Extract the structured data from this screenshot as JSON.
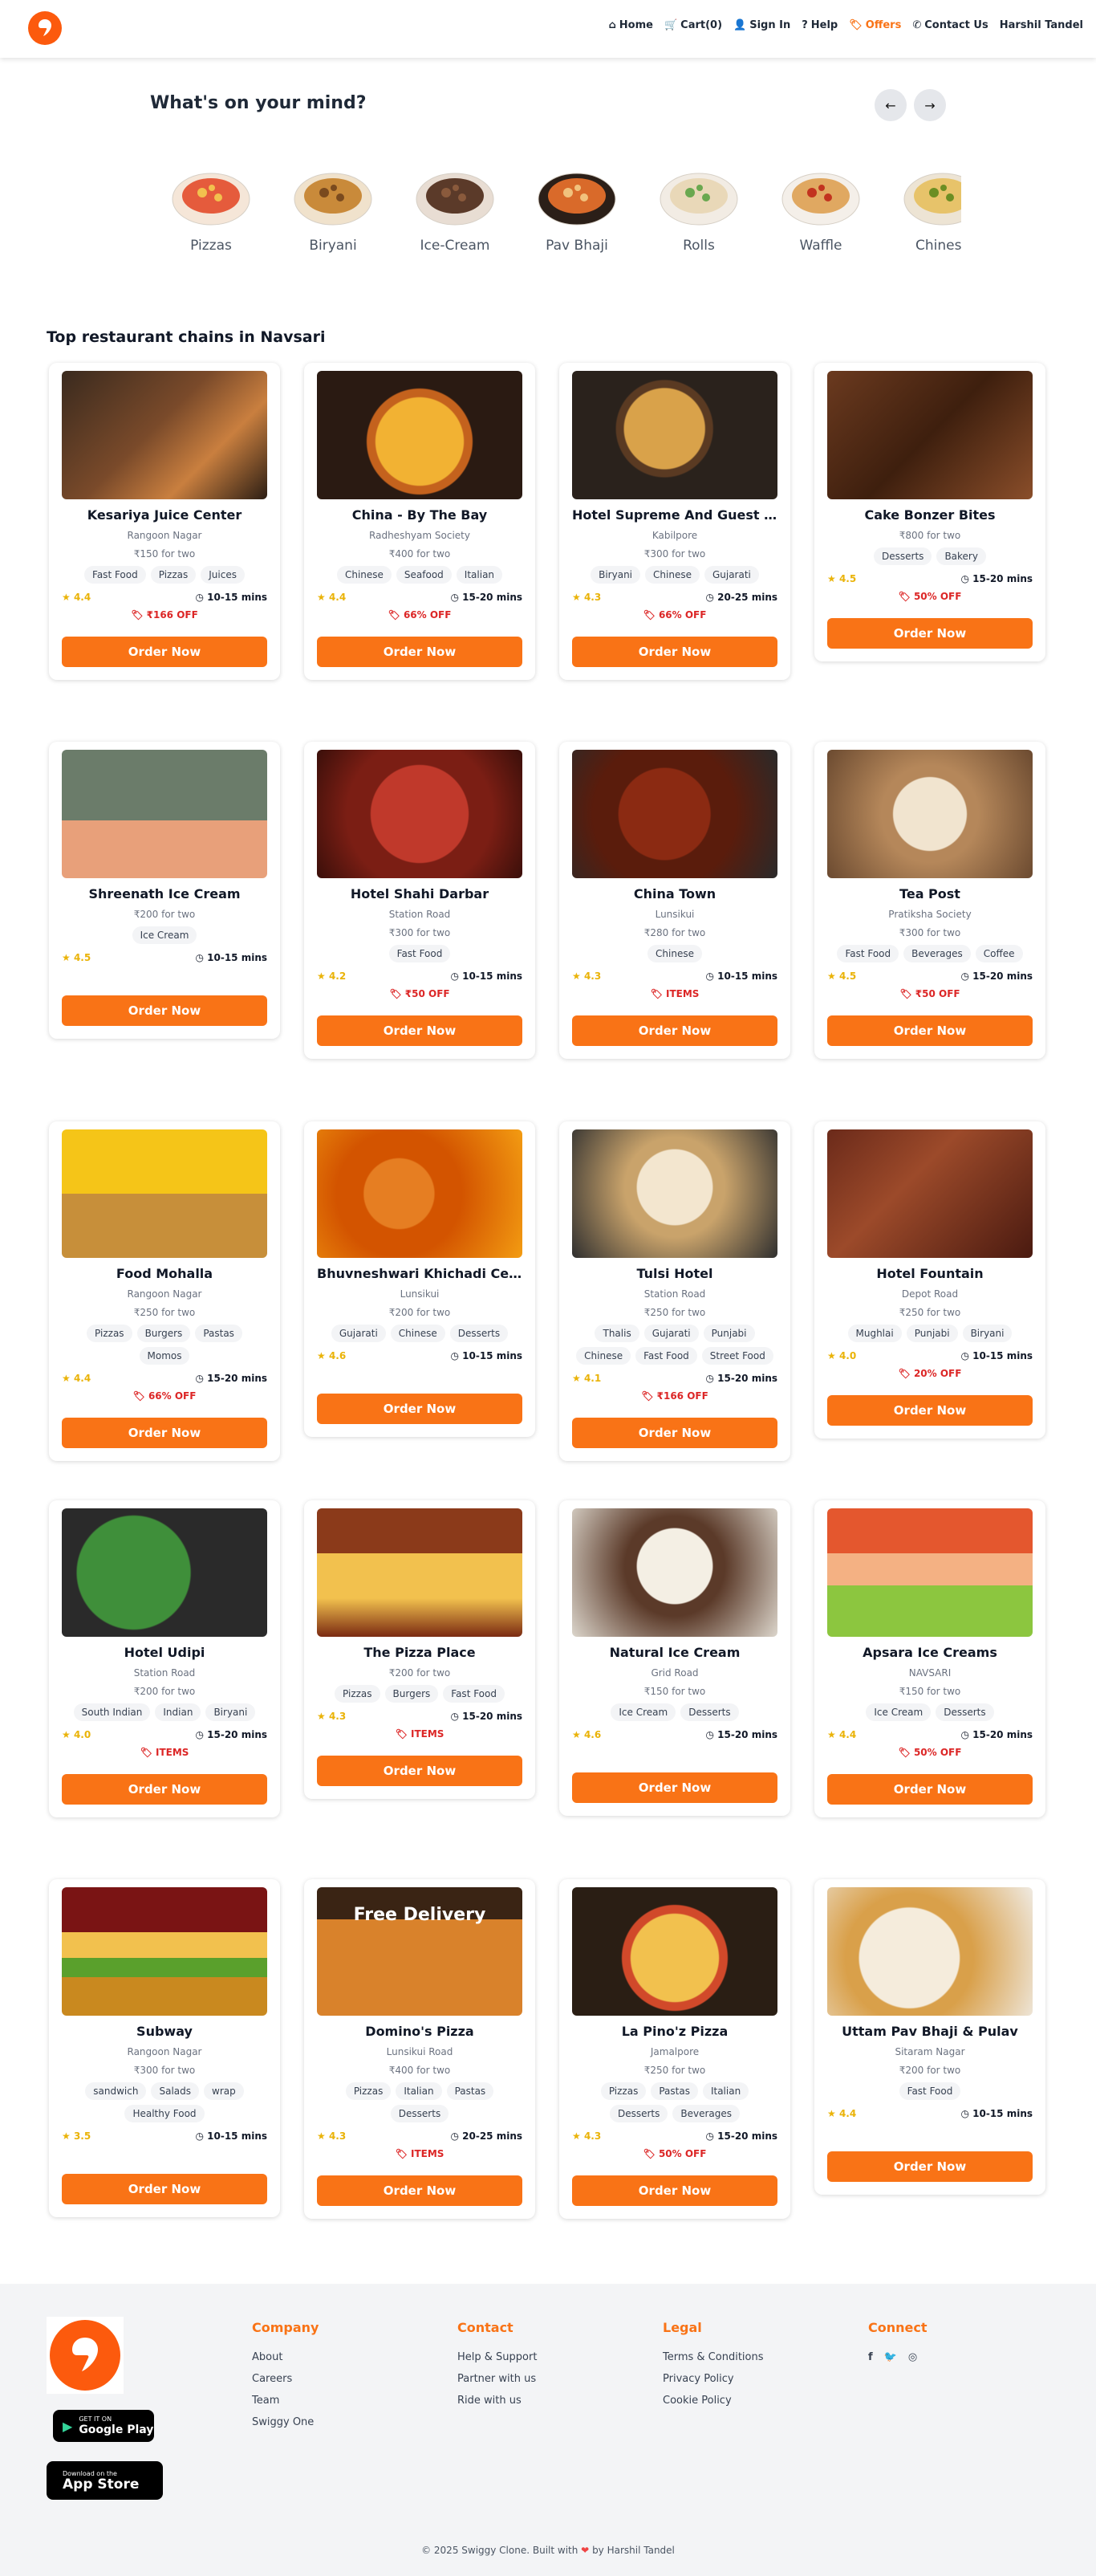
{
  "nav": {
    "links": [
      {
        "label": "Home",
        "icon": "home-icon"
      },
      {
        "label": "Cart(0)",
        "icon": "cart-icon"
      },
      {
        "label": "Sign In",
        "icon": "user-icon"
      },
      {
        "label": "Help",
        "icon": "help-icon"
      },
      {
        "label": "Offers",
        "icon": "tag-icon"
      },
      {
        "label": "Contact Us",
        "icon": "phone-icon"
      },
      {
        "label": "Harshil Tandel",
        "icon": ""
      }
    ]
  },
  "mind": {
    "title": "What's on your mind?",
    "categories": [
      "Pizzas",
      "Biryani",
      "Ice-Cream",
      "Pav Bhaji",
      "Rolls",
      "Waffle",
      "Chinese"
    ]
  },
  "section_title": "Top restaurant chains in Navsari",
  "order_label": "Order Now",
  "restaurants": [
    {
      "name": "Kesariya Juice Center",
      "loc": "Rangoon Nagar",
      "price": "₹150 for two",
      "tags": [
        "Fast Food",
        "Pizzas",
        "Juices"
      ],
      "rating": "4.4",
      "time": "10-15 mins",
      "offer": "₹166 OFF",
      "img": "grill"
    },
    {
      "name": "China - By The Bay",
      "loc": "Radheshyam Society",
      "price": "₹400 for two",
      "tags": [
        "Chinese",
        "Seafood",
        "Italian"
      ],
      "rating": "4.4",
      "time": "15-20 mins",
      "offer": "66% OFF",
      "img": "pizza"
    },
    {
      "name": "Hotel Supreme And Guest House",
      "loc": "Kabilpore",
      "price": "₹300 for two",
      "tags": [
        "Biryani",
        "Chinese",
        "Gujarati"
      ],
      "rating": "4.3",
      "time": "20-25 mins",
      "offer": "66% OFF",
      "img": "thali"
    },
    {
      "name": "Cake Bonzer Bites",
      "loc": "",
      "price": "₹800 for two",
      "tags": [
        "Desserts",
        "Bakery"
      ],
      "rating": "4.5",
      "time": "15-20 mins",
      "offer": "50% OFF",
      "img": "cake"
    },
    {
      "name": "Shreenath Ice Cream",
      "loc": "",
      "price": "₹200 for two",
      "tags": [
        "Ice Cream"
      ],
      "rating": "4.5",
      "time": "10-15 mins",
      "offer": "",
      "img": "juice"
    },
    {
      "name": "Hotel Shahi Darbar",
      "loc": "Station Road",
      "price": "₹300 for two",
      "tags": [
        "Fast Food"
      ],
      "rating": "4.2",
      "time": "10-15 mins",
      "offer": "₹50 OFF",
      "img": "redfood"
    },
    {
      "name": "China Town",
      "loc": "Lunsikui",
      "price": "₹280 for two",
      "tags": [
        "Chinese"
      ],
      "rating": "4.3",
      "time": "10-15 mins",
      "offer": "ITEMS",
      "img": "chilli"
    },
    {
      "name": "Tea Post",
      "loc": "Pratiksha Society",
      "price": "₹300 for two",
      "tags": [
        "Fast Food",
        "Beverages",
        "Coffee"
      ],
      "rating": "4.5",
      "time": "15-20 mins",
      "offer": "₹50 OFF",
      "img": "tea"
    },
    {
      "name": "Food Mohalla",
      "loc": "Rangoon Nagar",
      "price": "₹250 for two",
      "tags": [
        "Pizzas",
        "Burgers",
        "Pastas",
        "Momos"
      ],
      "rating": "4.4",
      "time": "15-20 mins",
      "offer": "66% OFF",
      "img": "shakes"
    },
    {
      "name": "Bhuvneshwari Khichadi Center",
      "loc": "Lunsikui",
      "price": "₹200 for two",
      "tags": [
        "Gujarati",
        "Chinese",
        "Desserts"
      ],
      "rating": "4.6",
      "time": "10-15 mins",
      "offer": "",
      "img": "laddu"
    },
    {
      "name": "Tulsi Hotel",
      "loc": "Station Road",
      "price": "₹250 for two",
      "tags": [
        "Thalis",
        "Gujarati",
        "Punjabi",
        "Chinese",
        "Fast Food",
        "Street Food"
      ],
      "rating": "4.1",
      "time": "15-20 mins",
      "offer": "₹166 OFF",
      "img": "rotis"
    },
    {
      "name": "Hotel Fountain",
      "loc": "Depot Road",
      "price": "₹250 for two",
      "tags": [
        "Mughlai",
        "Punjabi",
        "Biryani"
      ],
      "rating": "4.0",
      "time": "10-15 mins",
      "offer": "20% OFF",
      "img": "curry"
    },
    {
      "name": "Hotel Udipi",
      "loc": "Station Road",
      "price": "₹200 for two",
      "tags": [
        "South Indian",
        "Indian",
        "Biryani"
      ],
      "rating": "4.0",
      "time": "15-20 mins",
      "offer": "ITEMS",
      "img": "dosa"
    },
    {
      "name": "The Pizza Place",
      "loc": "",
      "price": "₹200 for two",
      "tags": [
        "Pizzas",
        "Burgers",
        "Fast Food"
      ],
      "rating": "4.3",
      "time": "15-20 mins",
      "offer": "ITEMS",
      "img": "cheese"
    },
    {
      "name": "Natural Ice Cream",
      "loc": "Grid Road",
      "price": "₹150 for two",
      "tags": [
        "Ice Cream",
        "Desserts"
      ],
      "rating": "4.6",
      "time": "15-20 mins",
      "offer": "",
      "img": "scoops"
    },
    {
      "name": "Apsara Ice Creams",
      "loc": "NAVSARI",
      "price": "₹150 for two",
      "tags": [
        "Ice Cream",
        "Desserts"
      ],
      "rating": "4.4",
      "time": "15-20 mins",
      "offer": "50% OFF",
      "img": "apsara"
    },
    {
      "name": "Subway",
      "loc": "Rangoon Nagar",
      "price": "₹300 for two",
      "tags": [
        "sandwich",
        "Salads",
        "wrap",
        "Healthy Food"
      ],
      "rating": "3.5",
      "time": "10-15 mins",
      "offer": "",
      "img": "sub"
    },
    {
      "name": "Domino's Pizza",
      "loc": "Lunsikui Road",
      "price": "₹400 for two",
      "tags": [
        "Pizzas",
        "Italian",
        "Pastas",
        "Desserts"
      ],
      "rating": "4.3",
      "time": "20-25 mins",
      "offer": "ITEMS",
      "img": "dominos",
      "banner": "Free Delivery"
    },
    {
      "name": "La Pino'z Pizza",
      "loc": "Jamalpore",
      "price": "₹250 for two",
      "tags": [
        "Pizzas",
        "Pastas",
        "Italian",
        "Desserts",
        "Beverages"
      ],
      "rating": "4.3",
      "time": "15-20 mins",
      "offer": "50% OFF",
      "img": "lapinoz"
    },
    {
      "name": "Uttam Pav Bhaji & Pulav",
      "loc": "Sitaram Nagar",
      "price": "₹200 for two",
      "tags": [
        "Fast Food"
      ],
      "rating": "4.4",
      "time": "10-15 mins",
      "offer": "",
      "img": "pav"
    }
  ],
  "footer": {
    "stores": [
      {
        "small": "GET IT ON",
        "big": "Google Play"
      },
      {
        "small": "Download on the",
        "big": "App Store"
      }
    ],
    "columns": [
      {
        "title": "Company",
        "items": [
          "About",
          "Careers",
          "Team",
          "Swiggy One"
        ]
      },
      {
        "title": "Contact",
        "items": [
          "Help & Support",
          "Partner with us",
          "Ride with us"
        ]
      },
      {
        "title": "Legal",
        "items": [
          "Terms & Conditions",
          "Privacy Policy",
          "Cookie Policy"
        ]
      },
      {
        "title": "Connect",
        "items": []
      }
    ],
    "social": [
      "facebook-icon",
      "twitter-icon",
      "instagram-icon"
    ],
    "copyright_pre": "© 2025 Swiggy Clone. Built with",
    "copyright_post": "by Harshil Tandel"
  }
}
